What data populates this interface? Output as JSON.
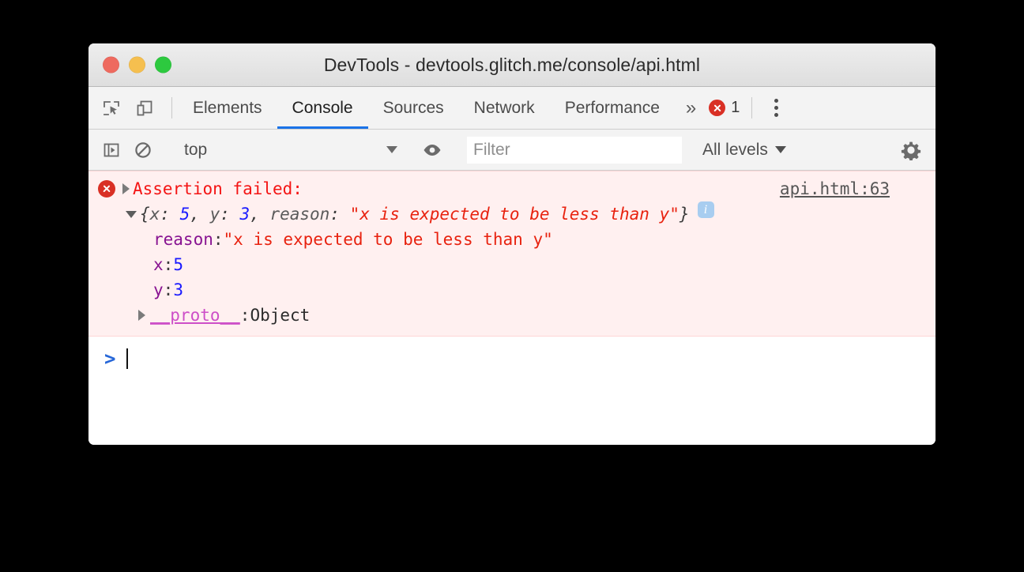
{
  "window": {
    "title": "DevTools - devtools.glitch.me/console/api.html",
    "controls": [
      {
        "name": "close",
        "color": "#ee6a5f"
      },
      {
        "name": "minimize",
        "color": "#f5bf4f"
      },
      {
        "name": "zoom",
        "color": "#2dc93f"
      }
    ]
  },
  "tabbar": {
    "inspect_icon": "inspect-element-icon",
    "device_icon": "device-toolbar-icon",
    "tabs": [
      {
        "label": "Elements",
        "active": false
      },
      {
        "label": "Console",
        "active": true
      },
      {
        "label": "Sources",
        "active": false
      },
      {
        "label": "Network",
        "active": false
      },
      {
        "label": "Performance",
        "active": false
      }
    ],
    "more_label": "»",
    "error_count": "1",
    "active_underline_color": "#1a73e8",
    "menu_icon": "kebab-menu-icon"
  },
  "toolbar": {
    "sidebar_icon": "console-sidebar-icon",
    "clear_icon": "clear-console-icon",
    "context": "top",
    "eye_icon": "live-expression-eye-icon",
    "filter_placeholder": "Filter",
    "filter_value": "",
    "levels": "All levels",
    "settings_icon": "settings-gear-icon"
  },
  "console": {
    "message": {
      "level": "error",
      "icon": "error-circle-icon",
      "text": "Assertion failed:",
      "source": "api.html:63",
      "background": "#fff0f0",
      "text_color": "#f41414",
      "object_preview": {
        "open_brace": "{",
        "close_brace": "}",
        "entries": [
          {
            "key": "x",
            "value": "5",
            "type": "number"
          },
          {
            "key": "y",
            "value": "3",
            "type": "number"
          },
          {
            "key": "reason",
            "value": "\"x is expected to be less than y\"",
            "type": "string"
          }
        ],
        "separator": ", ",
        "colon": ": ",
        "info_badge": "i"
      },
      "properties": [
        {
          "name": "reason",
          "value": "\"x is expected to be less than y\"",
          "type": "string"
        },
        {
          "name": "x",
          "value": "5",
          "type": "number"
        },
        {
          "name": "y",
          "value": "3",
          "type": "number"
        }
      ],
      "proto": {
        "name": "__proto__",
        "value": "Object"
      }
    },
    "prompt": {
      "arrow": ">",
      "value": ""
    }
  }
}
